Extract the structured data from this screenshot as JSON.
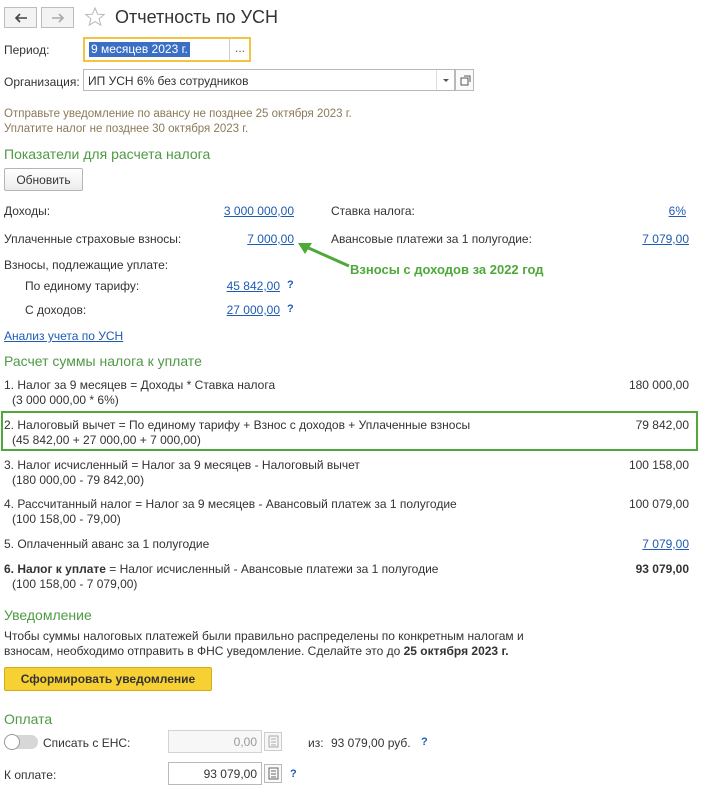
{
  "header": {
    "title": "Отчетность по УСН"
  },
  "period": {
    "label": "Период:",
    "value": "9 месяцев 2023 г.",
    "select_label": "..."
  },
  "org": {
    "label": "Организация:",
    "value": "ИП УСН 6% без сотрудников"
  },
  "notices": {
    "line1": "Отправьте уведомление по авансу не позднее 25 октября 2023 г.",
    "line2": "Уплатите налог не позднее 30 октября 2023 г."
  },
  "indicators": {
    "title": "Показатели для расчета налога",
    "refresh_label": "Обновить",
    "income_label": "Доходы:",
    "income_value": "3 000 000,00",
    "tax_rate_label": "Ставка налога:",
    "tax_rate_value": "6%",
    "paid_ins_label": "Уплаченные страховые взносы:",
    "paid_ins_value": "7 000,00",
    "advance_label": "Авансовые платежи за 1 полугодие:",
    "advance_value": "7 079,00",
    "contrib_due_label": "Взносы, подлежащие уплате:",
    "single_tariff_label": "По единому тарифу:",
    "single_tariff_value": "45 842,00",
    "from_income_label": "С доходов:",
    "from_income_value": "27 000,00",
    "help_mark": "?",
    "annotation": "Взносы с доходов за 2022 год"
  },
  "analysis_link": "Анализ учета по УСН",
  "calc": {
    "title": "Расчет суммы налога к уплате",
    "rows": [
      {
        "line1": "1. Налог за 9 месяцев = Доходы * Ставка налога",
        "line2": "(3 000 000,00 * 6%)",
        "value": "180 000,00"
      },
      {
        "line1": "2. Налоговый вычет = По единому тарифу + Взнос с доходов + Уплаченные взносы",
        "line2": "(45 842,00 + 27 000,00 + 7 000,00)",
        "value": "79 842,00"
      },
      {
        "line1": "3. Налог исчисленный = Налог за 9 месяцев - Налоговый вычет",
        "line2": "(180 000,00 - 79 842,00)",
        "value": "100 158,00"
      },
      {
        "line1": "4. Рассчитанный налог = Налог за 9 месяцев - Авансовый платеж за 1 полугодие",
        "line2": "(100 158,00 - 79,00)",
        "value": "100 079,00"
      },
      {
        "line1": "5. Оплаченный аванс за 1 полугодие",
        "value": "7 079,00"
      },
      {
        "line1_bold": "6. Налог к уплате",
        "line1_rest": " = Налог исчисленный - Авансовые платежи за 1 полугодие",
        "line2": "(100 158,00 - 7 079,00)",
        "value": "93 079,00"
      }
    ]
  },
  "notification": {
    "title": "Уведомление",
    "text1": "Чтобы суммы налоговых платежей были правильно распределены по конкретным налогам и",
    "text2": "взносам, необходимо отправить в ФНС уведомление. Сделайте это до ",
    "date": "25 октября 2023 г.",
    "button": "Сформировать уведомление"
  },
  "payment": {
    "title": "Оплата",
    "ens_label": "Списать с ЕНС:",
    "ens_value": "0,00",
    "from_label": "из:",
    "from_value": "93 079,00 руб.",
    "to_pay_label": "К оплате:",
    "to_pay_value": "93 079,00"
  },
  "colors": {
    "accent_green": "#4f9a45",
    "link_blue": "#1e5bb3",
    "highlight_yellow": "#f5c342",
    "button_yellow": "#f7d133"
  }
}
